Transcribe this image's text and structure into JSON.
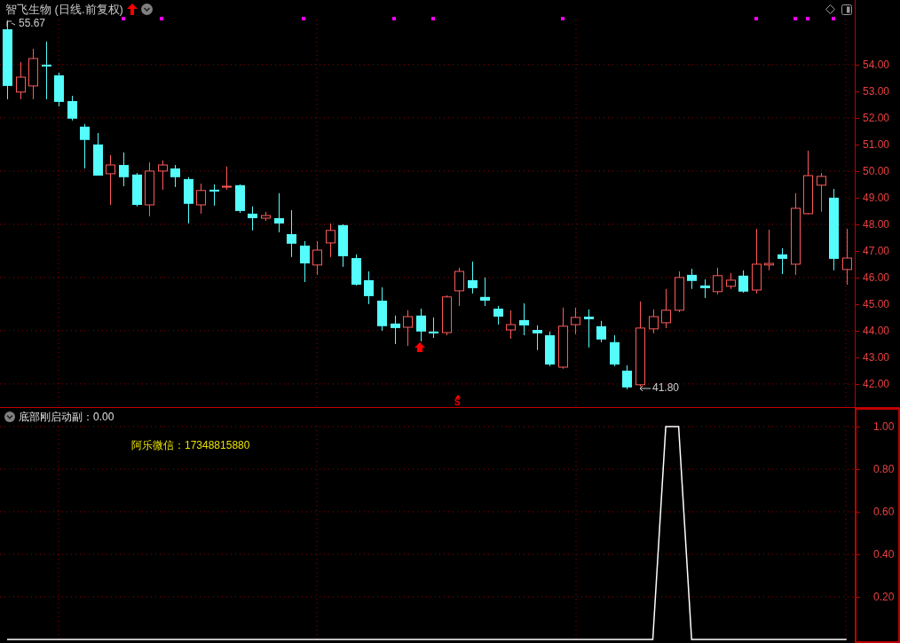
{
  "header": {
    "title": "智飞生物 (日线.前复权)"
  },
  "price_chart": {
    "high_label": "55.67",
    "low_label": "41.80",
    "signal_label": "S",
    "chart_data": {
      "type": "candlestick",
      "grid": true,
      "ohlc": [
        [
          55.33,
          55.67,
          52.7,
          53.2
        ],
        [
          52.97,
          54.1,
          52.7,
          53.53
        ],
        [
          53.2,
          54.6,
          52.7,
          54.23
        ],
        [
          54.0,
          54.87,
          52.7,
          53.93
        ],
        [
          53.6,
          53.7,
          52.43,
          52.6
        ],
        [
          52.63,
          52.83,
          51.9,
          51.97
        ],
        [
          51.67,
          51.77,
          50.1,
          51.17
        ],
        [
          51.0,
          51.43,
          49.83,
          49.83
        ],
        [
          49.9,
          50.6,
          48.73,
          50.23
        ],
        [
          50.23,
          50.7,
          49.43,
          49.77
        ],
        [
          49.87,
          49.93,
          48.67,
          48.73
        ],
        [
          48.73,
          50.33,
          48.3,
          50.0
        ],
        [
          50.0,
          50.4,
          49.3,
          50.23
        ],
        [
          50.1,
          50.23,
          49.4,
          49.77
        ],
        [
          49.7,
          49.77,
          48.03,
          48.77
        ],
        [
          48.73,
          49.53,
          48.4,
          49.27
        ],
        [
          49.3,
          49.5,
          48.7,
          49.23
        ],
        [
          49.4,
          50.17,
          49.3,
          49.43
        ],
        [
          49.47,
          49.5,
          48.43,
          48.5
        ],
        [
          48.4,
          48.67,
          47.77,
          48.23
        ],
        [
          48.23,
          48.47,
          48.13,
          48.33
        ],
        [
          48.23,
          49.17,
          47.7,
          48.03
        ],
        [
          47.63,
          48.53,
          46.77,
          47.27
        ],
        [
          47.2,
          47.37,
          45.83,
          46.53
        ],
        [
          46.47,
          47.37,
          46.1,
          47.03
        ],
        [
          47.3,
          48.03,
          46.77,
          47.77
        ],
        [
          47.97,
          48.0,
          46.4,
          46.8
        ],
        [
          46.73,
          46.87,
          45.7,
          45.73
        ],
        [
          45.9,
          46.23,
          45.0,
          45.3
        ],
        [
          45.13,
          45.63,
          44.0,
          44.17
        ],
        [
          44.27,
          44.57,
          43.5,
          44.1
        ],
        [
          44.13,
          44.77,
          43.43,
          44.53
        ],
        [
          44.57,
          44.83,
          43.6,
          43.97
        ],
        [
          43.97,
          44.5,
          43.73,
          43.9
        ],
        [
          43.93,
          45.33,
          43.83,
          45.27
        ],
        [
          45.5,
          46.37,
          44.93,
          46.23
        ],
        [
          45.9,
          46.6,
          45.4,
          45.6
        ],
        [
          45.27,
          46.0,
          44.93,
          45.13
        ],
        [
          44.83,
          44.93,
          44.23,
          44.53
        ],
        [
          44.03,
          44.77,
          43.7,
          44.23
        ],
        [
          44.4,
          45.03,
          43.83,
          44.2
        ],
        [
          44.03,
          44.2,
          43.27,
          43.9
        ],
        [
          43.83,
          43.97,
          42.67,
          42.73
        ],
        [
          42.63,
          44.87,
          42.57,
          44.17
        ],
        [
          44.23,
          44.87,
          43.87,
          44.5
        ],
        [
          44.53,
          44.8,
          43.37,
          44.43
        ],
        [
          44.17,
          44.37,
          43.57,
          43.67
        ],
        [
          43.57,
          43.83,
          42.67,
          42.73
        ],
        [
          42.5,
          42.7,
          41.8,
          41.87
        ],
        [
          41.97,
          45.1,
          41.9,
          44.1
        ],
        [
          44.07,
          44.8,
          43.9,
          44.53
        ],
        [
          44.3,
          45.57,
          44.1,
          44.77
        ],
        [
          44.77,
          46.23,
          44.7,
          46.0
        ],
        [
          46.1,
          46.33,
          45.57,
          45.87
        ],
        [
          45.7,
          45.93,
          45.23,
          45.6
        ],
        [
          45.47,
          46.37,
          45.37,
          46.07
        ],
        [
          45.67,
          46.17,
          45.57,
          45.9
        ],
        [
          46.07,
          46.27,
          45.43,
          45.47
        ],
        [
          45.53,
          47.83,
          45.4,
          46.5
        ],
        [
          46.47,
          47.8,
          46.27,
          46.53
        ],
        [
          46.87,
          47.1,
          46.13,
          46.7
        ],
        [
          46.5,
          49.17,
          46.1,
          48.6
        ],
        [
          48.4,
          50.77,
          48.37,
          49.83
        ],
        [
          49.47,
          49.93,
          48.47,
          49.8
        ],
        [
          49.0,
          49.33,
          46.27,
          46.7
        ],
        [
          46.3,
          47.83,
          45.73,
          46.73
        ]
      ],
      "ylim": [
        41.13,
        56.43
      ],
      "yticks": [
        {
          "value": 54,
          "label": "54.00"
        },
        {
          "value": 53,
          "label": "53.00"
        },
        {
          "value": 52,
          "label": "52.00"
        },
        {
          "value": 51,
          "label": "51.00"
        },
        {
          "value": 50,
          "label": "50.00"
        },
        {
          "value": 49,
          "label": "49.00"
        },
        {
          "value": 48,
          "label": "48.00"
        },
        {
          "value": 47,
          "label": "47.00"
        },
        {
          "value": 46,
          "label": "46.00"
        },
        {
          "value": 45,
          "label": "45.00"
        },
        {
          "value": 44,
          "label": "44.00"
        },
        {
          "value": 43,
          "label": "43.00"
        },
        {
          "value": 42,
          "label": "42.00"
        }
      ]
    }
  },
  "indicator": {
    "value": "：0.00",
    "note": "阿乐微信：17348815880",
    "chart_data": {
      "type": "line",
      "grid": true,
      "series": [
        {
          "name": "底部刚启动副",
          "color": "#ffffff",
          "values": [
            0,
            0,
            0,
            0,
            0,
            0,
            0,
            0,
            0,
            0,
            0,
            0,
            0,
            0,
            0,
            0,
            0,
            0,
            0,
            0,
            0,
            0,
            0,
            0,
            0,
            0,
            0,
            0,
            0,
            0,
            0,
            0,
            0,
            0,
            0,
            0,
            0,
            0,
            0,
            0,
            0,
            0,
            0,
            0,
            0,
            0,
            0,
            0,
            0,
            0,
            0,
            1,
            1,
            0,
            0,
            0,
            0,
            0,
            0,
            0,
            0,
            0,
            0,
            0,
            0,
            0
          ]
        }
      ],
      "ylim": [
        -0.017,
        1
      ],
      "yticks": [
        {
          "value": 1,
          "label": "1.00"
        },
        {
          "value": 0.8,
          "label": "0.80"
        },
        {
          "value": 0.6,
          "label": "0.60"
        },
        {
          "value": 0.4,
          "label": "0.40"
        },
        {
          "value": 0.2,
          "label": "0.20"
        }
      ]
    }
  }
}
